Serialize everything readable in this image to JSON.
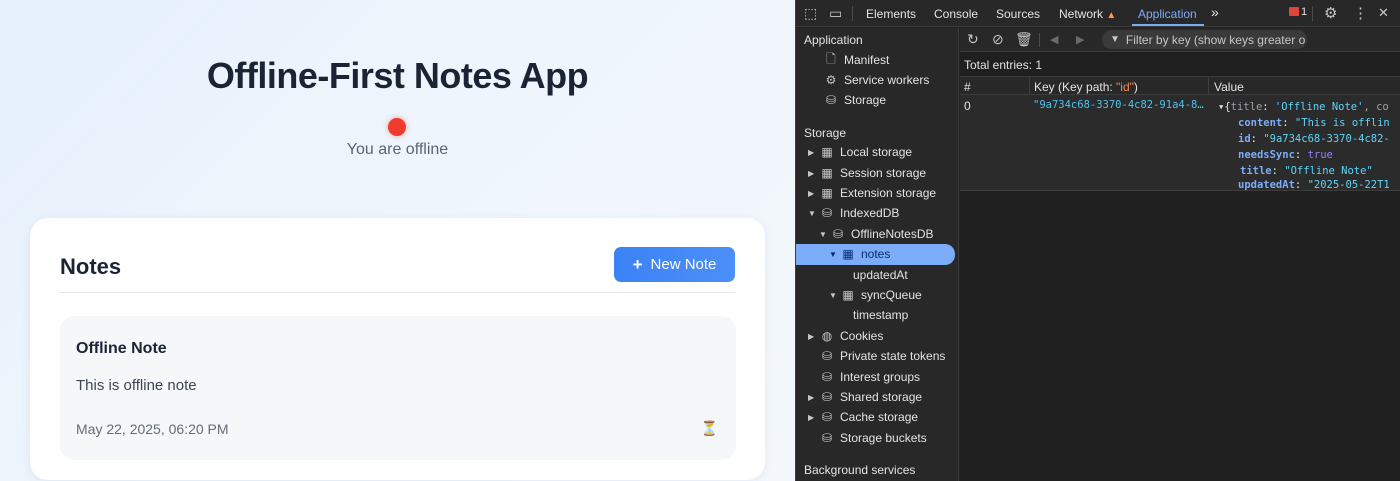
{
  "app": {
    "title": "Offline-First Notes App",
    "status_text": "You are offline",
    "status_color": "#ef3b2d",
    "notes_heading": "Notes",
    "new_note_icon": "+",
    "new_note_label": "New Note",
    "notes": [
      {
        "title": "Offline Note",
        "content": "This is offline note",
        "date": "May 22, 2025, 06:20 PM",
        "status_icon": "⏳"
      }
    ]
  },
  "devtools": {
    "tabs": [
      "Elements",
      "Console",
      "Sources",
      "Network",
      "Application"
    ],
    "active_tab": "Application",
    "more_tabs": "»",
    "error_count": "1",
    "sidebar": {
      "application_header": "Application",
      "application_items": [
        "Manifest",
        "Service workers",
        "Storage"
      ],
      "storage_header": "Storage",
      "storage_items": {
        "local": "Local storage",
        "session": "Session storage",
        "extension": "Extension storage",
        "indexeddb": "IndexedDB",
        "db": "OfflineNotesDB",
        "notes_store": "notes",
        "notes_index": "updatedAt",
        "sync_store": "syncQueue",
        "sync_index": "timestamp",
        "cookies": "Cookies",
        "private_tokens": "Private state tokens",
        "interest_groups": "Interest groups",
        "shared_storage": "Shared storage",
        "cache_storage": "Cache storage",
        "storage_buckets": "Storage buckets"
      },
      "background_header": "Background services"
    },
    "toolbar": {
      "filter_placeholder": "Filter by key (show keys greater o"
    },
    "total_entries": "Total entries: 1",
    "table": {
      "col_num": "#",
      "col_key_prefix": "Key (Key path: ",
      "col_key_path": "\"id\"",
      "col_key_suffix": ")",
      "col_value": "Value",
      "row": {
        "index": "0",
        "key": "\"9a734c68-3370-4c82-91a4-8…",
        "value_summary_open": "{",
        "value_summary_title_key": "title",
        "value_summary_title_val": "'Offline Note'",
        "value_summary_rest": ", co",
        "props": [
          {
            "key": "content",
            "value": "\"This is offlin",
            "type": "string"
          },
          {
            "key": "id",
            "value": "\"9a734c68-3370-4c82-",
            "type": "string"
          },
          {
            "key": "needsSync",
            "value": "true",
            "type": "bool"
          },
          {
            "key": "title",
            "value": "\"Offline Note\"",
            "type": "string"
          },
          {
            "key": "updatedAt",
            "value": "\"2025-05-22T1",
            "type": "string"
          }
        ]
      }
    }
  }
}
